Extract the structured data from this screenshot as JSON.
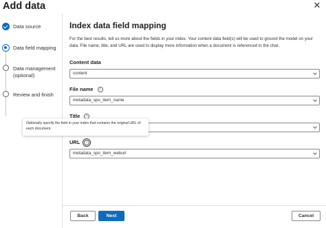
{
  "dialog": {
    "title": "Add data",
    "close_glyph": "✕"
  },
  "steps": [
    {
      "label": "Data source",
      "status": "done"
    },
    {
      "label": "Data field mapping",
      "status": "current"
    },
    {
      "label": "Data management (optional)",
      "status": "todo"
    },
    {
      "label": "Review and finish",
      "status": "todo"
    }
  ],
  "main": {
    "title": "Index data field mapping",
    "description": "For the best results, tell us more about the fields in your index. Your content data field(s) will be used to ground the model on your data. File name, title, and URL are used to display more information when a document is referenced in the chat."
  },
  "fields": {
    "content": {
      "label": "Content data",
      "value": "content"
    },
    "file_name": {
      "label": "File name",
      "value": "metadata_spo_item_name",
      "info_icon": "info-icon"
    },
    "title": {
      "label": "Title",
      "value": "",
      "info_icon": "info-icon"
    },
    "url": {
      "label": "URL",
      "value": "metadata_spo_item_weburi",
      "info_icon": "info-icon"
    }
  },
  "tooltip": {
    "text": "Optionally specify the field in your index that contains the original URL of each document."
  },
  "footer": {
    "back_label": "Back",
    "next_label": "Next",
    "cancel_label": "Cancel"
  },
  "colors": {
    "accent": "#0f6cbd",
    "border": "#8a8886",
    "divider": "#e1dfdd"
  }
}
